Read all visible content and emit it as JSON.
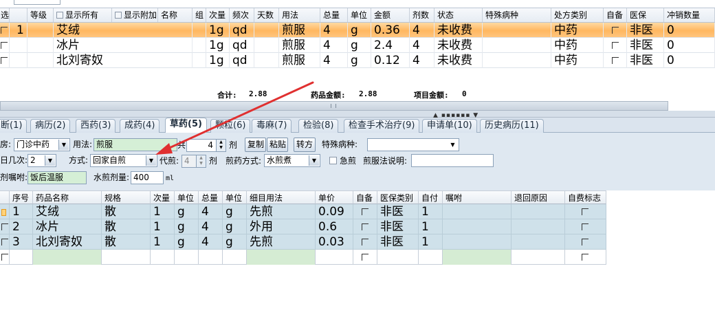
{
  "top_grid": {
    "headers": [
      "选",
      "",
      "等级",
      "显示所有",
      "显示附加",
      "名称",
      "组",
      "次量",
      "频次",
      "天数",
      "用法",
      "总量",
      "单位",
      "金额",
      "剂数",
      "状态",
      "特殊病种",
      "处方类别",
      "自备",
      "医保",
      "冲销数量"
    ],
    "rows": [
      {
        "idx": "1",
        "name": "艾绒",
        "dose": "1g",
        "freq": "qd",
        "usage": "煎服",
        "total": "4",
        "unit": "g",
        "amount": "0.36",
        "count": "4",
        "status": "未收费",
        "category": "中药",
        "insurance": "非医",
        "writeoff": "0"
      },
      {
        "idx": "",
        "name": "冰片",
        "dose": "1g",
        "freq": "qd",
        "usage": "煎服",
        "total": "4",
        "unit": "g",
        "amount": "2.4",
        "count": "4",
        "status": "未收费",
        "category": "中药",
        "insurance": "非医",
        "writeoff": "0"
      },
      {
        "idx": "",
        "name": "北刘寄奴",
        "dose": "1g",
        "freq": "qd",
        "usage": "煎服",
        "total": "4",
        "unit": "g",
        "amount": "0.12",
        "count": "4",
        "status": "未收费",
        "category": "中药",
        "insurance": "非医",
        "writeoff": "0"
      }
    ],
    "totals": {
      "sum_label": "合计:",
      "sum_value": "2.88",
      "drug_label": "药品金额:",
      "drug_value": "2.88",
      "item_label": "项目金额:",
      "item_value": "0"
    }
  },
  "tabs": [
    "断(1)",
    "病历(2)",
    "西药(3)",
    "成药(4)",
    "草药(5)",
    "颗粒(6)",
    "毒麻(7)",
    "检验(8)",
    "检查手术治疗(9)",
    "申请单(10)",
    "历史病历(11)"
  ],
  "active_tab": 4,
  "form": {
    "pharmacy_label": "房:",
    "pharmacy_value": "门诊中药",
    "usage_label": "用法:",
    "usage_value": "煎服",
    "total_label": "共",
    "total_value": "4",
    "total_unit": "剂",
    "copy_button": "复制",
    "paste_button": "粘贴",
    "convert_button": "转方",
    "special_label": "特殊病种:",
    "special_value": "",
    "daily_label": "日几次:",
    "daily_value": "2",
    "method_label": "方式:",
    "method_value": "回家自煎",
    "decoct_label": "代煎:",
    "decoct_value": "4",
    "decoct_unit": "剂",
    "decoct_method_label": "煎药方式:",
    "decoct_method_value": "水煎煮",
    "urgent_label": "急煎",
    "decoct_note_label": "煎服法说明:",
    "decoct_note_value": "",
    "advice_label": "剂嘱咐:",
    "advice_value": "饭后温服",
    "water_label": "水煎剂量:",
    "water_value": "400",
    "water_unit": "ml"
  },
  "bottom_grid": {
    "headers": [
      "",
      "序号",
      "药品名称",
      "规格",
      "次量",
      "单位",
      "总量",
      "单位",
      "细目用法",
      "单价",
      "自备",
      "医保类别",
      "自付",
      "嘱咐",
      "退回原因",
      "自费标志"
    ],
    "rows": [
      {
        "no": "1",
        "name": "艾绒",
        "spec": "散",
        "dose": "1",
        "unit": "g",
        "total": "4",
        "tunit": "g",
        "usage": "先煎",
        "price": "0.09",
        "insurance": "非医",
        "selfpay": "1"
      },
      {
        "no": "2",
        "name": "冰片",
        "spec": "散",
        "dose": "1",
        "unit": "g",
        "total": "4",
        "tunit": "g",
        "usage": "外用",
        "price": "0.6",
        "insurance": "非医",
        "selfpay": "1"
      },
      {
        "no": "3",
        "name": "北刘寄奴",
        "spec": "散",
        "dose": "1",
        "unit": "g",
        "total": "4",
        "tunit": "g",
        "usage": "先煎",
        "price": "0.03",
        "insurance": "非医",
        "selfpay": "1"
      }
    ]
  },
  "colors": {
    "selected_row": "#ffb760",
    "annotation_arrow": "#e03030",
    "bottom_row": "#cfe1ea",
    "green_cell": "#d5ecd3"
  }
}
